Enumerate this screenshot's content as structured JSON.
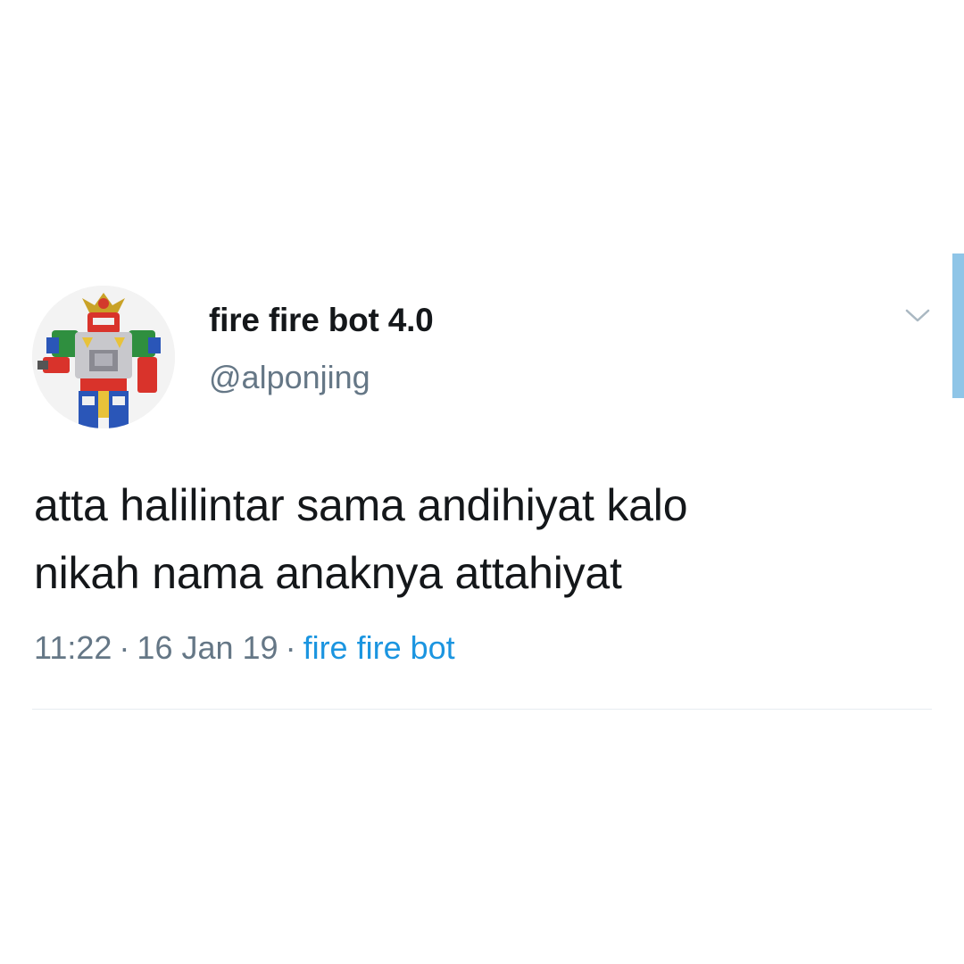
{
  "tweet": {
    "author": {
      "display_name": "fire fire bot 4.0",
      "handle": "@alponjing",
      "avatar_icon": "robot-toy-avatar"
    },
    "text_line_1": "atta halilintar sama andihiyat kalo",
    "text_line_2": "nikah nama anaknya attahiyat",
    "time": "11:22",
    "date": "16 Jan 19",
    "separator": "·",
    "source": "fire fire bot",
    "menu_icon": "chevron-down-icon"
  },
  "colors": {
    "text": "#14171a",
    "secondary": "#657786",
    "link": "#1b95e0",
    "divider": "#e6ecf0",
    "scroll_indicator": "#8fc5e7"
  }
}
